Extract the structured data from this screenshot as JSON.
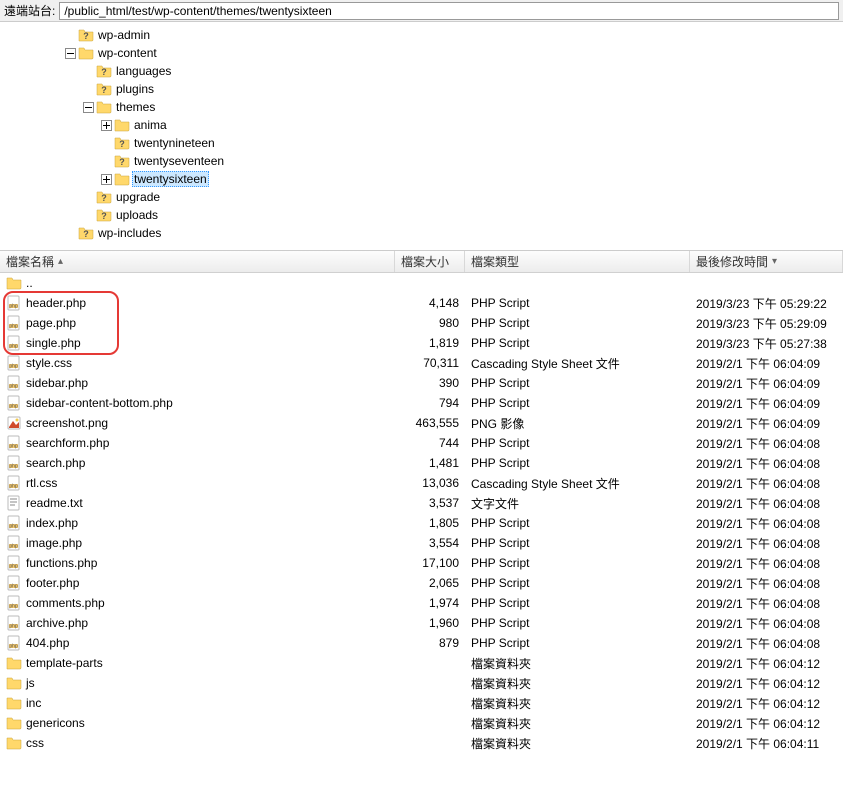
{
  "pathbar": {
    "label": "遠端站台:",
    "value": "/public_html/test/wp-content/themes/twentysixteen"
  },
  "tree": [
    {
      "depth": 0,
      "twisty": "none",
      "icon": "folder-q",
      "label": "wp-admin"
    },
    {
      "depth": 0,
      "twisty": "minus",
      "icon": "folder",
      "label": "wp-content"
    },
    {
      "depth": 1,
      "twisty": "none",
      "icon": "folder-q",
      "label": "languages"
    },
    {
      "depth": 1,
      "twisty": "none",
      "icon": "folder-q",
      "label": "plugins"
    },
    {
      "depth": 1,
      "twisty": "minus",
      "icon": "folder",
      "label": "themes"
    },
    {
      "depth": 2,
      "twisty": "plus",
      "icon": "folder",
      "label": "anima"
    },
    {
      "depth": 2,
      "twisty": "none",
      "icon": "folder-q",
      "label": "twentynineteen"
    },
    {
      "depth": 2,
      "twisty": "none",
      "icon": "folder-q",
      "label": "twentyseventeen"
    },
    {
      "depth": 2,
      "twisty": "plus",
      "icon": "folder",
      "label": "twentysixteen",
      "selected": true
    },
    {
      "depth": 1,
      "twisty": "none",
      "icon": "folder-q",
      "label": "upgrade"
    },
    {
      "depth": 1,
      "twisty": "none",
      "icon": "folder-q",
      "label": "uploads"
    },
    {
      "depth": 0,
      "twisty": "none",
      "icon": "folder-q",
      "label": "wp-includes"
    }
  ],
  "columns": {
    "name": "檔案名稱",
    "size": "檔案大小",
    "type": "檔案類型",
    "date": "最後修改時間"
  },
  "files": [
    {
      "icon": "folder",
      "name": "..",
      "size": "",
      "type": "",
      "date": ""
    },
    {
      "icon": "php",
      "name": "header.php",
      "size": "4,148",
      "type": "PHP Script",
      "date": "2019/3/23 下午 05:29:22",
      "hl": true
    },
    {
      "icon": "php",
      "name": "page.php",
      "size": "980",
      "type": "PHP Script",
      "date": "2019/3/23 下午 05:29:09",
      "hl": true
    },
    {
      "icon": "php",
      "name": "single.php",
      "size": "1,819",
      "type": "PHP Script",
      "date": "2019/3/23 下午 05:27:38",
      "hl": true
    },
    {
      "icon": "php",
      "name": "style.css",
      "size": "70,311",
      "type": "Cascading Style Sheet 文件",
      "date": "2019/2/1 下午 06:04:09"
    },
    {
      "icon": "php",
      "name": "sidebar.php",
      "size": "390",
      "type": "PHP Script",
      "date": "2019/2/1 下午 06:04:09"
    },
    {
      "icon": "php",
      "name": "sidebar-content-bottom.php",
      "size": "794",
      "type": "PHP Script",
      "date": "2019/2/1 下午 06:04:09"
    },
    {
      "icon": "png",
      "name": "screenshot.png",
      "size": "463,555",
      "type": "PNG 影像",
      "date": "2019/2/1 下午 06:04:09"
    },
    {
      "icon": "php",
      "name": "searchform.php",
      "size": "744",
      "type": "PHP Script",
      "date": "2019/2/1 下午 06:04:08"
    },
    {
      "icon": "php",
      "name": "search.php",
      "size": "1,481",
      "type": "PHP Script",
      "date": "2019/2/1 下午 06:04:08"
    },
    {
      "icon": "php",
      "name": "rtl.css",
      "size": "13,036",
      "type": "Cascading Style Sheet 文件",
      "date": "2019/2/1 下午 06:04:08"
    },
    {
      "icon": "txt",
      "name": "readme.txt",
      "size": "3,537",
      "type": "文字文件",
      "date": "2019/2/1 下午 06:04:08"
    },
    {
      "icon": "php",
      "name": "index.php",
      "size": "1,805",
      "type": "PHP Script",
      "date": "2019/2/1 下午 06:04:08"
    },
    {
      "icon": "php",
      "name": "image.php",
      "size": "3,554",
      "type": "PHP Script",
      "date": "2019/2/1 下午 06:04:08"
    },
    {
      "icon": "php",
      "name": "functions.php",
      "size": "17,100",
      "type": "PHP Script",
      "date": "2019/2/1 下午 06:04:08"
    },
    {
      "icon": "php",
      "name": "footer.php",
      "size": "2,065",
      "type": "PHP Script",
      "date": "2019/2/1 下午 06:04:08"
    },
    {
      "icon": "php",
      "name": "comments.php",
      "size": "1,974",
      "type": "PHP Script",
      "date": "2019/2/1 下午 06:04:08"
    },
    {
      "icon": "php",
      "name": "archive.php",
      "size": "1,960",
      "type": "PHP Script",
      "date": "2019/2/1 下午 06:04:08"
    },
    {
      "icon": "php",
      "name": "404.php",
      "size": "879",
      "type": "PHP Script",
      "date": "2019/2/1 下午 06:04:08"
    },
    {
      "icon": "folder",
      "name": "template-parts",
      "size": "",
      "type": "檔案資料夾",
      "date": "2019/2/1 下午 06:04:12"
    },
    {
      "icon": "folder",
      "name": "js",
      "size": "",
      "type": "檔案資料夾",
      "date": "2019/2/1 下午 06:04:12"
    },
    {
      "icon": "folder",
      "name": "inc",
      "size": "",
      "type": "檔案資料夾",
      "date": "2019/2/1 下午 06:04:12"
    },
    {
      "icon": "folder",
      "name": "genericons",
      "size": "",
      "type": "檔案資料夾",
      "date": "2019/2/1 下午 06:04:12"
    },
    {
      "icon": "folder",
      "name": "css",
      "size": "",
      "type": "檔案資料夾",
      "date": "2019/2/1 下午 06:04:11"
    }
  ]
}
